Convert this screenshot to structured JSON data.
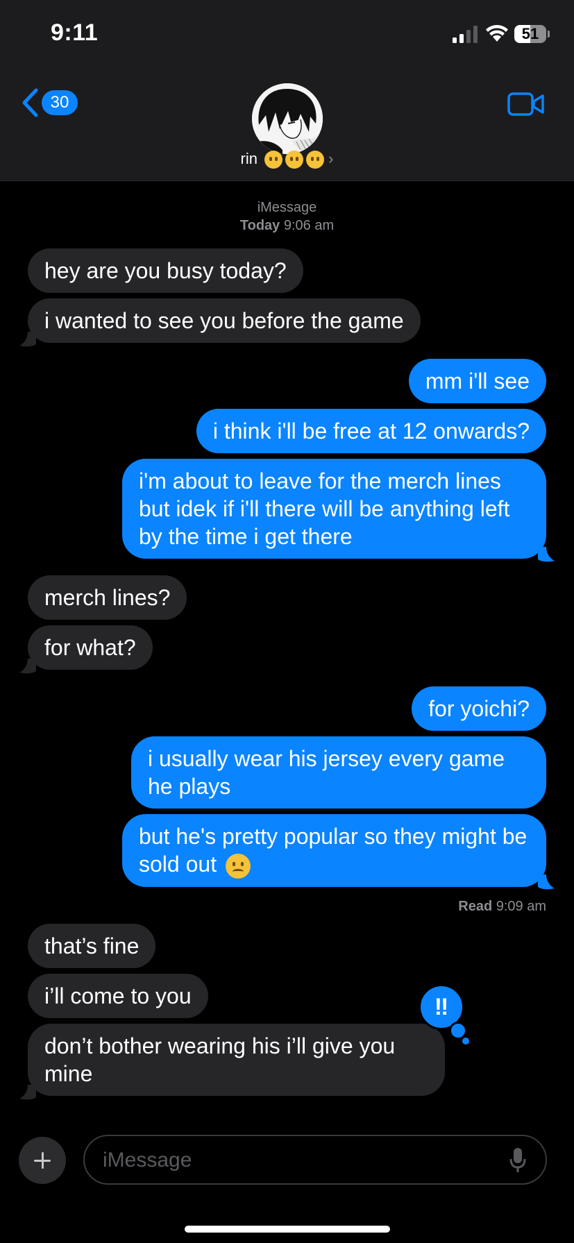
{
  "status": {
    "time": "9:11",
    "battery": "51",
    "battery_level": 0.51
  },
  "header": {
    "back_count": "30",
    "contact_name": "rin"
  },
  "thread": {
    "service": "iMessage",
    "day": "Today",
    "time": "9:06 am",
    "messages": [
      {
        "dir": "in",
        "text": "hey are you busy today?"
      },
      {
        "dir": "in",
        "text": "i wanted to see you before the game"
      },
      {
        "dir": "out",
        "text": "mm i'll see"
      },
      {
        "dir": "out",
        "text": "i think i'll be free at 12 onwards?"
      },
      {
        "dir": "out",
        "text": "i'm about to leave for the merch lines but idek if i'll there will be anything left by the time i get there"
      },
      {
        "dir": "in",
        "text": "merch lines?"
      },
      {
        "dir": "in",
        "text": "for what?"
      },
      {
        "dir": "out",
        "text": "for yoichi?"
      },
      {
        "dir": "out",
        "text": "i usually wear his jersey every game he plays"
      },
      {
        "dir": "out",
        "text": "but he's pretty popular so they might be sold out"
      },
      {
        "dir": "in",
        "text": "that’s fine"
      },
      {
        "dir": "in",
        "text": "i’ll come to you"
      },
      {
        "dir": "in",
        "text": "don’t bother wearing his i’ll give you mine"
      }
    ],
    "read_label": "Read",
    "read_time": "9:09 am",
    "tapback": "‼"
  },
  "composer": {
    "placeholder": "iMessage"
  },
  "icons": {
    "back": "chevron-left-icon",
    "video": "video-camera-icon",
    "plus": "plus-icon",
    "mic": "microphone-icon"
  },
  "colors": {
    "accent": "#0a84ff",
    "incoming": "#262629",
    "background": "#000000",
    "header": "#1c1c1e"
  }
}
